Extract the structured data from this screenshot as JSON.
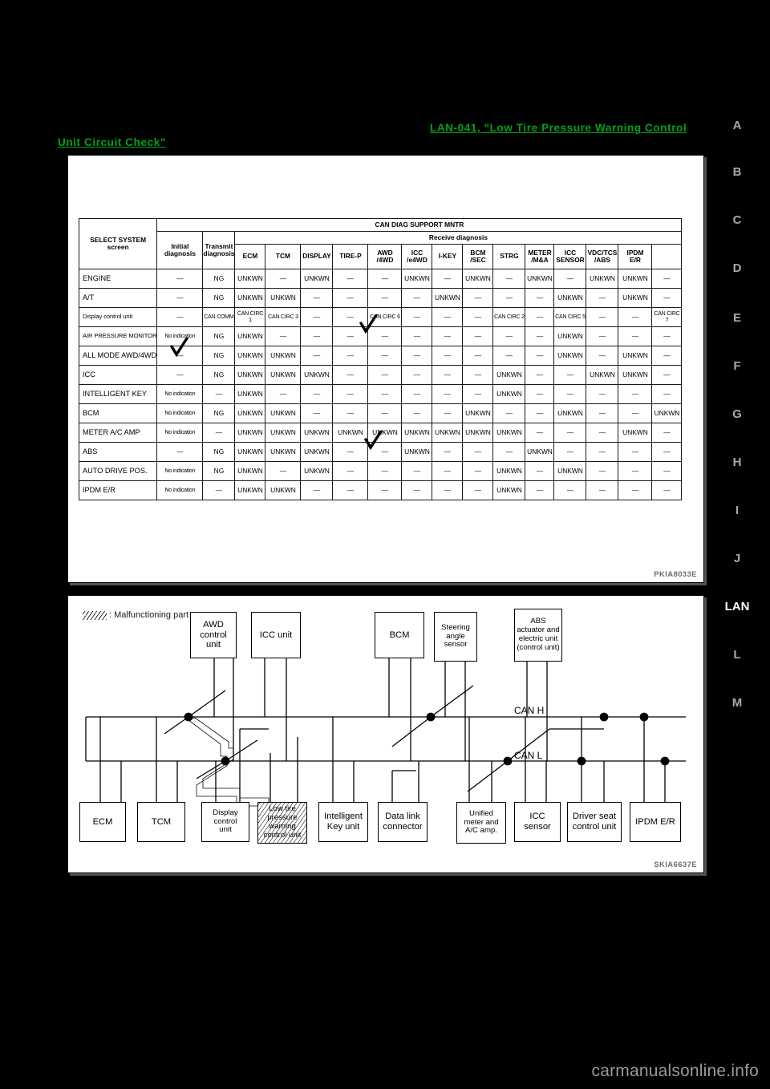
{
  "links": {
    "top": "LAN-041, \"Low Tire Pressure Warning Control",
    "bottom": "Unit Circuit Check\""
  },
  "index_rail": {
    "items": [
      "A",
      "B",
      "C",
      "D",
      "E",
      "F",
      "G",
      "H",
      "I",
      "J",
      "LAN",
      "L",
      "M"
    ],
    "active": "LAN"
  },
  "table_figure": {
    "figure_id": "PKIA8033E",
    "headers": {
      "select_system": "SELECT SYSTEM screen",
      "can_diag": "CAN DIAG SUPPORT MNTR",
      "initial_diagnosis": "Initial\ndiagnosis",
      "initial_diagnosis_l1": "Initial",
      "initial_diagnosis_l2": "diagnosis",
      "transmit_diagnosis_l1": "Transmit",
      "transmit_diagnosis_l2": "diagnosis",
      "receive_diagnosis": "Receive diagnosis",
      "receive_columns": [
        {
          "l1": "ECM",
          "l2": ""
        },
        {
          "l1": "TCM",
          "l2": ""
        },
        {
          "l1": "DISPLAY",
          "l2": ""
        },
        {
          "l1": "TIRE-P",
          "l2": ""
        },
        {
          "l1": "AWD",
          "l2": "/4WD"
        },
        {
          "l1": "ICC",
          "l2": "/e4WD"
        },
        {
          "l1": "I-KEY",
          "l2": ""
        },
        {
          "l1": "BCM",
          "l2": "/SEC"
        },
        {
          "l1": "STRG",
          "l2": ""
        },
        {
          "l1": "METER",
          "l2": "/M&A"
        },
        {
          "l1": "ICC",
          "l2": "SENSOR"
        },
        {
          "l1": "VDC/TCS",
          "l2": "/ABS"
        },
        {
          "l1": "IPDM",
          "l2": "E/R"
        }
      ]
    },
    "rows": [
      {
        "system": "ENGINE",
        "initial": "—",
        "transmit": "NG",
        "receive": [
          "UNKWN",
          "—",
          "UNKWN",
          "—",
          "—",
          "UNKWN",
          "—",
          "UNKWN",
          "—",
          "UNKWN",
          "—",
          "UNKWN",
          "UNKWN"
        ]
      },
      {
        "system": "A/T",
        "initial": "—",
        "transmit": "NG",
        "receive": [
          "UNKWN",
          "UNKWN",
          "—",
          "—",
          "—",
          "—",
          "UNKWN",
          "—",
          "—",
          "—",
          "UNKWN",
          "—",
          "UNKWN",
          "—"
        ]
      },
      {
        "system": "Display control unit",
        "initial": "—",
        "transmit": "CAN COMM",
        "receive": [
          "CAN CIRC 1",
          "CAN CIRC 3",
          "—",
          "—",
          "CAN CIRC 6",
          "—",
          "—",
          "—",
          "CAN CIRC 2",
          "—",
          "CAN CIRC 5",
          "—",
          "—",
          "CAN CIRC 7"
        ]
      },
      {
        "system": "AIR PRESSURE MONITOR",
        "initial": "No indication",
        "transmit": "NG",
        "receive": [
          "UNKWN",
          "—",
          "—",
          "—",
          "—",
          "—",
          "—",
          "—",
          "—",
          "—",
          "UNKWN",
          "—",
          "—",
          "—"
        ]
      },
      {
        "system": "ALL MODE AWD/4WD",
        "initial": "—",
        "transmit": "NG",
        "receive": [
          "UNKWN",
          "UNKWN",
          "—",
          "—",
          "—",
          "—",
          "—",
          "—",
          "—",
          "—",
          "UNKWN",
          "—",
          "UNKWN",
          "—"
        ]
      },
      {
        "system": "ICC",
        "initial": "—",
        "transmit": "NG",
        "receive": [
          "UNKWN",
          "UNKWN",
          "UNKWN",
          "—",
          "—",
          "—",
          "—",
          "—",
          "UNKWN",
          "—",
          "—",
          "UNKWN",
          "UNKWN",
          "—"
        ]
      },
      {
        "system": "INTELLIGENT KEY",
        "initial": "No indication",
        "transmit": "—",
        "receive": [
          "UNKWN",
          "—",
          "—",
          "—",
          "—",
          "—",
          "—",
          "—",
          "UNKWN",
          "—",
          "—",
          "—",
          "—",
          "—"
        ]
      },
      {
        "system": "BCM",
        "initial": "No indication",
        "transmit": "NG",
        "receive": [
          "UNKWN",
          "UNKWN",
          "—",
          "—",
          "—",
          "—",
          "—",
          "UNKWN",
          "—",
          "—",
          "UNKWN",
          "—",
          "—",
          "UNKWN"
        ]
      },
      {
        "system": "METER A/C AMP",
        "initial": "No indication",
        "transmit": "—",
        "receive": [
          "UNKWN",
          "UNKWN",
          "UNKWN",
          "UNKWN",
          "UNKWN",
          "UNKWN",
          "UNKWN",
          "UNKWN",
          "UNKWN",
          "—",
          "—",
          "—",
          "UNKWN",
          "—"
        ]
      },
      {
        "system": "ABS",
        "initial": "—",
        "transmit": "NG",
        "receive": [
          "UNKWN",
          "UNKWN",
          "UNKWN",
          "—",
          "—",
          "UNKWN",
          "—",
          "—",
          "—",
          "UNKWN",
          "—",
          "—",
          "—",
          "—"
        ]
      },
      {
        "system": "AUTO DRIVE POS.",
        "initial": "No indication",
        "transmit": "NG",
        "receive": [
          "UNKWN",
          "—",
          "UNKWN",
          "—",
          "—",
          "—",
          "—",
          "—",
          "UNKWN",
          "—",
          "UNKWN",
          "—",
          "—",
          "—"
        ]
      },
      {
        "system": "IPDM E/R",
        "initial": "No indication",
        "transmit": "—",
        "receive": [
          "UNKWN",
          "UNKWN",
          "—",
          "—",
          "—",
          "—",
          "—",
          "—",
          "UNKWN",
          "—",
          "—",
          "—",
          "—",
          "—"
        ]
      }
    ]
  },
  "diagram_figure": {
    "figure_id": "SKIA6637E",
    "legend_label": ": Malfunctioning part",
    "bus_labels": {
      "can_h": "CAN H",
      "can_l": "CAN L"
    },
    "top_nodes": [
      {
        "id": "awd-control-unit",
        "label": "AWD control\nunit"
      },
      {
        "id": "icc-unit",
        "label": "ICC unit"
      },
      {
        "id": "bcm",
        "label": "BCM"
      },
      {
        "id": "steering-angle-sensor",
        "label": "Steering\nangle\nsensor"
      },
      {
        "id": "abs-actuator",
        "label": "ABS\nactuator and\nelectric unit\n(control unit)"
      }
    ],
    "bottom_nodes": [
      {
        "id": "ecm",
        "label": "ECM"
      },
      {
        "id": "tcm",
        "label": "TCM"
      },
      {
        "id": "display-control-unit",
        "label": "Display\ncontrol\nunit"
      },
      {
        "id": "low-tire-pressure-warning-control-unit",
        "label": "Low tire\npressure\nwarning\ncontrol unit",
        "malfunctioning": true
      },
      {
        "id": "intelligent-key-unit",
        "label": "Intelligent\nKey unit"
      },
      {
        "id": "data-link-connector",
        "label": "Data link\nconnector"
      },
      {
        "id": "unified-meter-and-ac-amp",
        "label": "Unified\nmeter and\nA/C amp."
      },
      {
        "id": "icc-sensor",
        "label": "ICC\nsensor"
      },
      {
        "id": "driver-seat-control-unit",
        "label": "Driver seat\ncontrol unit"
      },
      {
        "id": "ipdm-er",
        "label": "IPDM E/R"
      }
    ]
  },
  "watermark": "carmanualsonline.info"
}
